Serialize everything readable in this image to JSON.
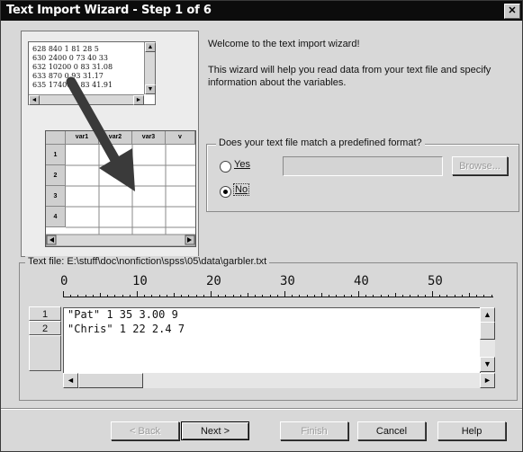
{
  "window": {
    "title": "Text Import Wizard - Step 1 of 6",
    "close_glyph": "✕"
  },
  "illustration": {
    "notepad_lines": [
      "628 840 1 81 28 5",
      "630 2400 0 73 40 33",
      "632 10200 0 83 31.08",
      "633 870 0 93 31.17",
      "635 17400 0 83 41.91"
    ],
    "grid_headers": [
      "var1",
      "var2",
      "var3",
      "v"
    ],
    "grid_rows": [
      "1",
      "2",
      "3",
      "4"
    ]
  },
  "intro": {
    "welcome": "Welcome to the text import wizard!",
    "description": "This wizard will help you read data from your text file and specify information about the variables."
  },
  "format": {
    "question": "Does your text file match a predefined format?",
    "yes_label": "Yes",
    "no_label": "No",
    "selected": "No",
    "browse_label": "Browse..."
  },
  "file": {
    "legend": "Text file: E:\\stuff\\doc\\nonfiction\\spss\\05\\data\\garbler.txt",
    "ruler": [
      "0",
      "10",
      "20",
      "30",
      "40",
      "50"
    ],
    "row_numbers": [
      "1",
      "2"
    ],
    "lines": [
      "\"Pat\" 1 35 3.00 9",
      "\"Chris\" 1 22 2.4 7"
    ]
  },
  "buttons": {
    "back": "< Back",
    "next": "Next >",
    "finish": "Finish",
    "cancel": "Cancel",
    "help": "Help"
  },
  "colors": {
    "titlebar": "#0c0c0c",
    "dialog_bg": "#d8d8d8",
    "arrow": "#3a3a3a"
  }
}
